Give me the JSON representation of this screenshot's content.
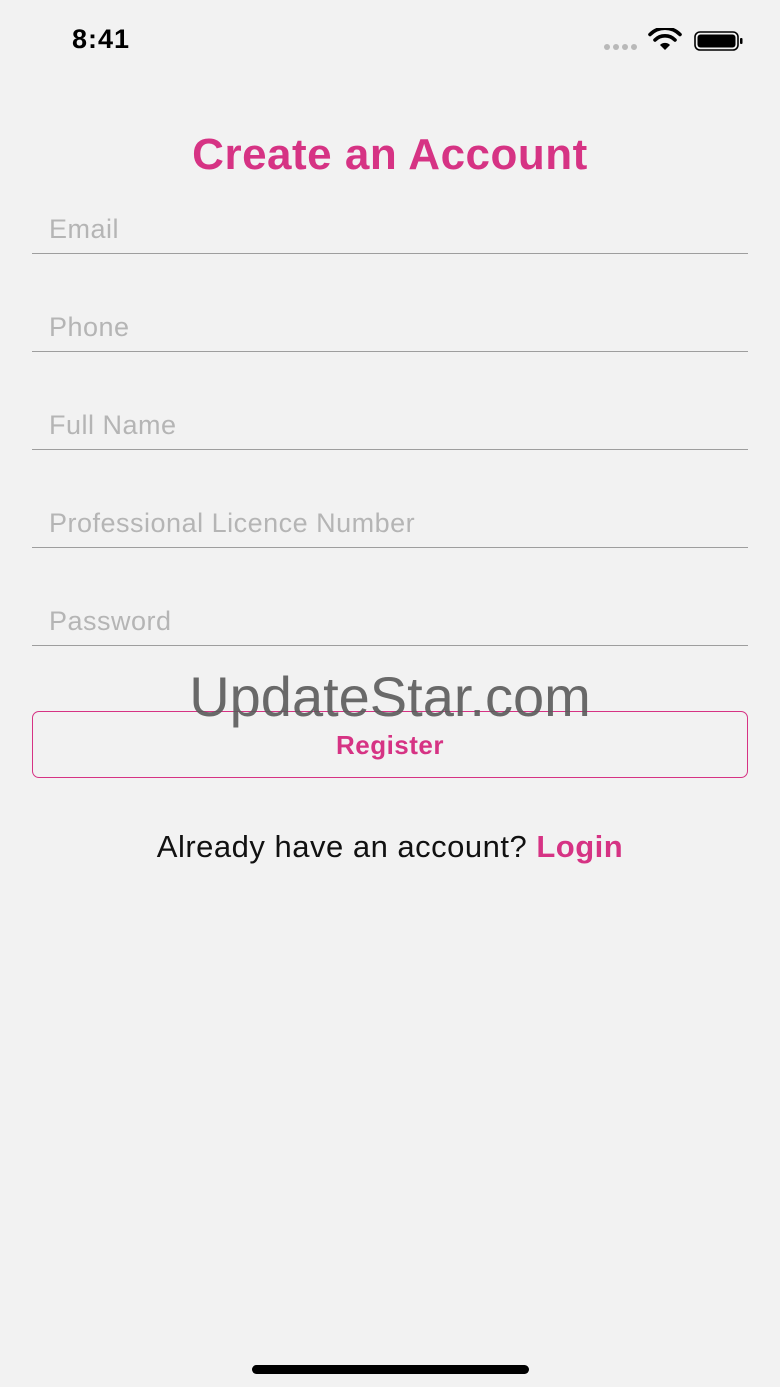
{
  "status_bar": {
    "time": "8:41"
  },
  "page": {
    "title": "Create an Account"
  },
  "form": {
    "email_placeholder": "Email",
    "phone_placeholder": "Phone",
    "full_name_placeholder": "Full Name",
    "licence_placeholder": "Professional Licence Number",
    "password_placeholder": "Password",
    "register_label": "Register"
  },
  "footer": {
    "prompt": "Already have an account?",
    "login_label": "Login"
  },
  "watermark": "UpdateStar.com",
  "colors": {
    "accent": "#d63384",
    "background": "#f2f2f2"
  }
}
